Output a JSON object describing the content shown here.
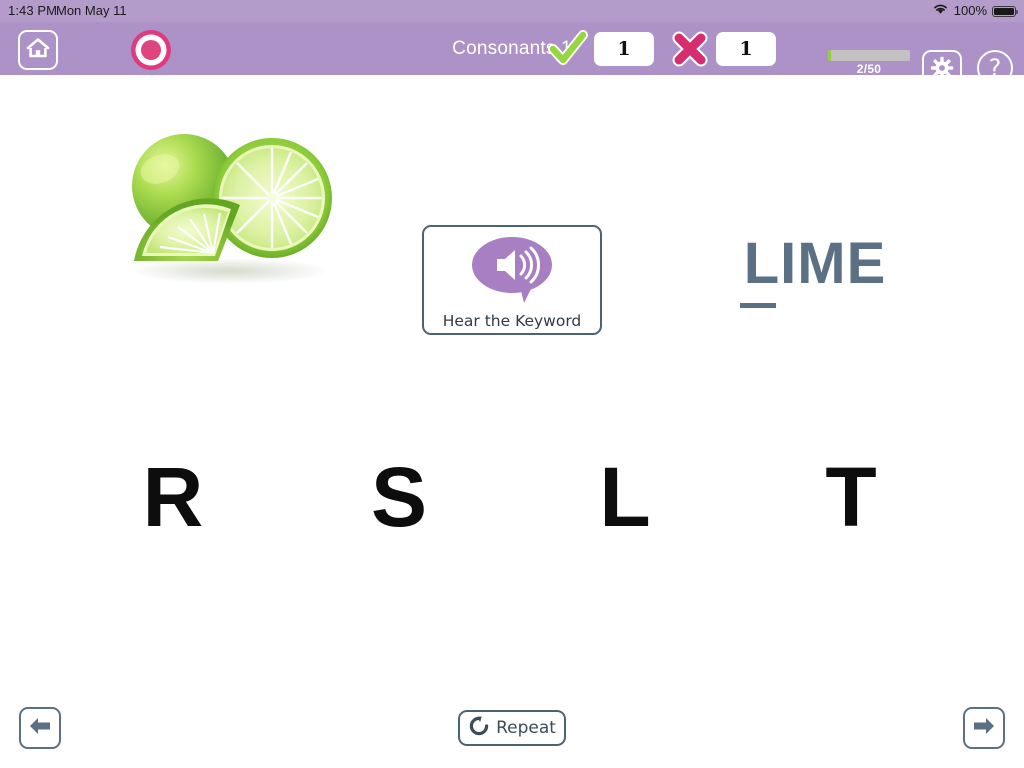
{
  "statusbar": {
    "time": "1:43 PM",
    "date": "Mon May 11",
    "battery_percent": "100%",
    "wifi_icon": "wifi-icon",
    "battery_icon": "battery-full-icon"
  },
  "header": {
    "title": "Consonants 1",
    "home_icon": "home-icon",
    "record_icon": "record-icon",
    "correct_icon": "checkmark-icon",
    "correct_count": "1",
    "incorrect_icon": "x-mark-icon",
    "incorrect_count": "1",
    "progress_label": "2/50",
    "progress_current": 2,
    "progress_total": 50,
    "progress_percent": 4,
    "settings_icon": "gear-icon",
    "help_icon": "question-mark-icon",
    "colors": {
      "bar": "#ac92c6",
      "correct": "#8fd13f",
      "incorrect": "#d62d6f",
      "record": "#e03a7c",
      "progress_fill": "#8fd13f",
      "progress_track": "#c2c2c2"
    }
  },
  "main": {
    "picture_alt": "lime",
    "hear_button_label": "Hear the Keyword",
    "hear_button_icon": "speaker-speech-bubble-icon",
    "keyword": "LIME",
    "keyword_underlined_letter": "L",
    "keyword_color": "#5b7084",
    "choices": [
      {
        "letter": "R"
      },
      {
        "letter": "S"
      },
      {
        "letter": "L"
      },
      {
        "letter": "T"
      }
    ]
  },
  "footer": {
    "prev_icon": "arrow-left-icon",
    "next_icon": "arrow-right-icon",
    "repeat_label": "Repeat",
    "repeat_icon": "replay-circular-arrow-icon"
  }
}
